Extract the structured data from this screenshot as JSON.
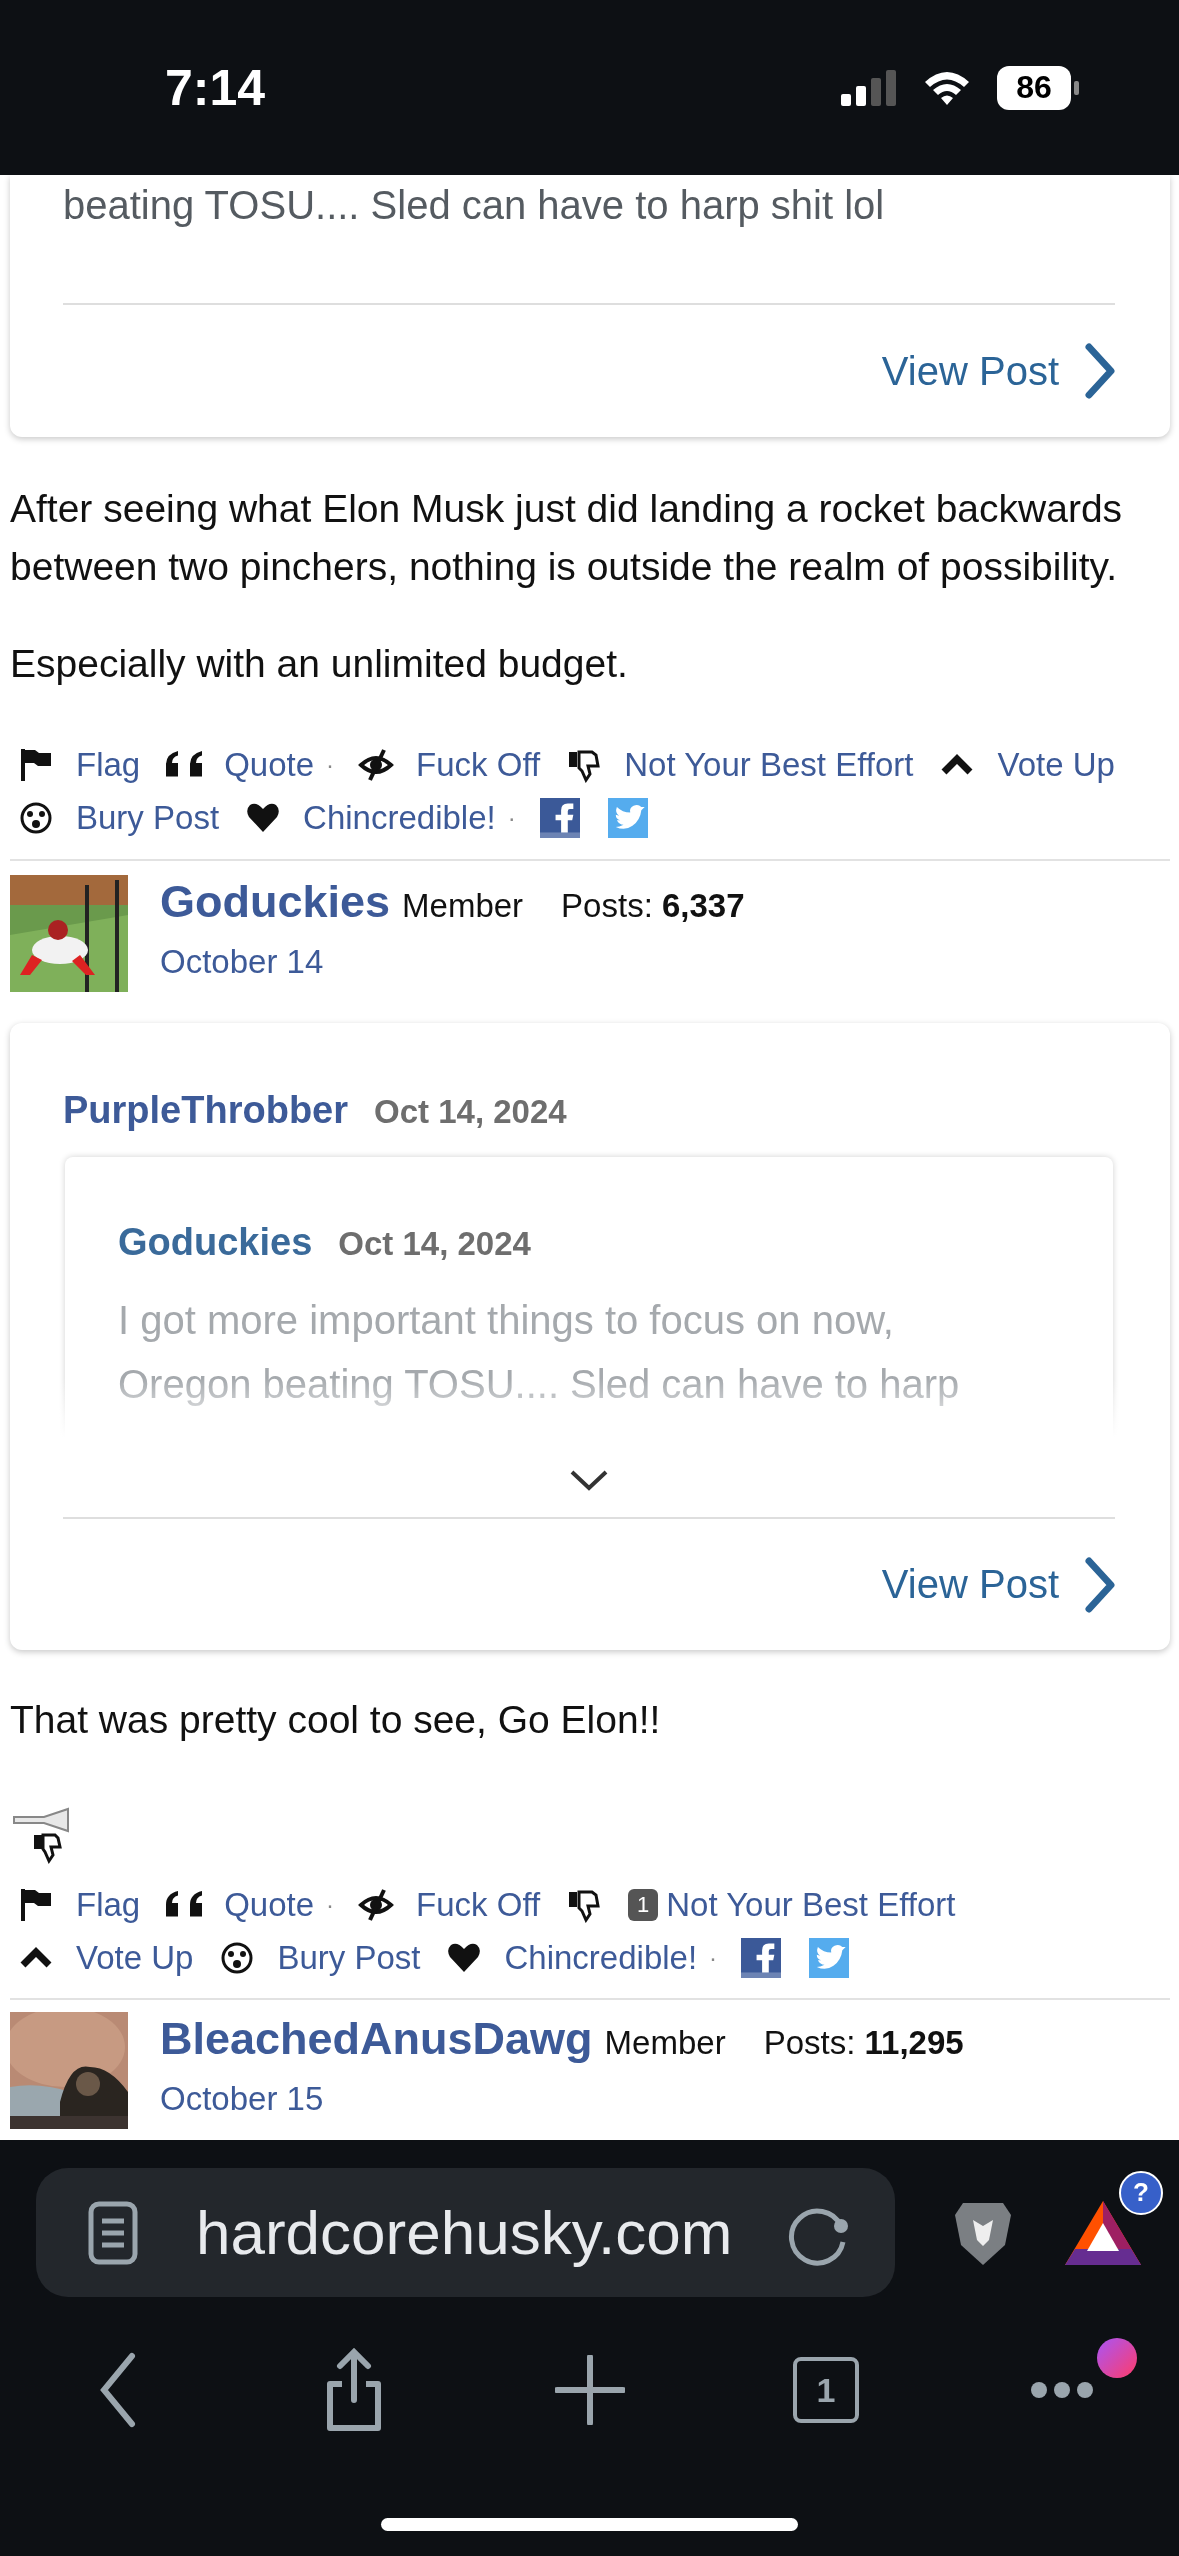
{
  "status_bar": {
    "time": "7:14",
    "battery": "86"
  },
  "top_quote_card": {
    "text": "beating TOSU.... Sled can have to harp shit lol",
    "link": "View Post"
  },
  "post_1": {
    "paragraphs": [
      "After seeing what Elon Musk just did landing a rocket backwards between two pinchers, nothing is outside the realm of possibility.",
      "Especially with an unlimited budget."
    ],
    "action_rows": [
      [
        {
          "kind": "flag",
          "label": "Flag"
        },
        {
          "kind": "quote",
          "label": "Quote"
        },
        {
          "kind": "separator",
          "text": "·"
        },
        {
          "kind": "ignore",
          "label": "Fuck Off"
        },
        {
          "kind": "dislike",
          "label": "Not Your Best Effort"
        },
        {
          "kind": "vote_up",
          "label": "Vote Up"
        }
      ],
      [
        {
          "kind": "bury",
          "label": "Bury Post"
        },
        {
          "kind": "like",
          "label": "Chincredible!"
        },
        {
          "kind": "separator",
          "text": "·"
        },
        {
          "kind": "facebook"
        },
        {
          "kind": "twitter"
        }
      ]
    ]
  },
  "user_1": {
    "name": "Goduckies",
    "role": "Member",
    "posts": "Posts: **6,337**",
    "date": "October 14"
  },
  "quote_card": {
    "author": "PurpleThrobber",
    "date": "Oct 14, 2024",
    "nested_quote": {
      "author": "Goduckies",
      "date": "Oct 14, 2024",
      "text": "I got more important things to focus on now, Oregon beating TOSU.... Sled can have to harp"
    },
    "link": "View Post"
  },
  "post_2": {
    "paragraphs": [
      "That was pretty cool to see, Go Elon!!"
    ],
    "action_rows": [
      [
        {
          "kind": "flag",
          "label": "Flag"
        },
        {
          "kind": "quote",
          "label": "Quote"
        },
        {
          "kind": "separator",
          "text": "·"
        },
        {
          "kind": "ignore",
          "label": "Fuck Off"
        },
        {
          "kind": "dislike",
          "label": "Not Your Best Effort",
          "count": "1"
        }
      ],
      [
        {
          "kind": "vote_up",
          "label": "Vote Up"
        },
        {
          "kind": "bury",
          "label": "Bury Post"
        },
        {
          "kind": "like",
          "label": "Chincredible!"
        },
        {
          "kind": "separator",
          "text": "·"
        },
        {
          "kind": "facebook"
        },
        {
          "kind": "twitter"
        }
      ]
    ]
  },
  "user_2": {
    "name": "BleachedAnusDawg",
    "role": "Member",
    "posts": "Posts: **11,295**",
    "date": "October 15"
  },
  "browser": {
    "url": "hardcorehusky.com",
    "rewards_badge": "?",
    "tab_count": "1"
  }
}
